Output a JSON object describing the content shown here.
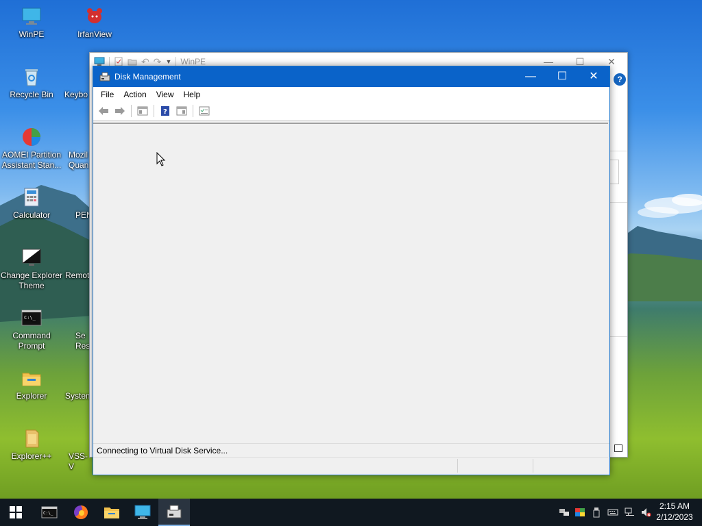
{
  "desktop": {
    "icons": [
      {
        "label": "WinPE"
      },
      {
        "label": "IrfanView"
      },
      {
        "label": "Recycle Bin"
      },
      {
        "label": "Keybo"
      },
      {
        "label": "AOMEI Partition Assistant Stan..."
      },
      {
        "label": "Mozil Quan"
      },
      {
        "label": "Calculator"
      },
      {
        "label": "PEN"
      },
      {
        "label": "Change Explorer Theme"
      },
      {
        "label": "Remot"
      },
      {
        "label": "Command Prompt"
      },
      {
        "label": "Se Res"
      },
      {
        "label": "Explorer"
      },
      {
        "label": "System"
      },
      {
        "label": "Explorer++"
      },
      {
        "label": "VSS-V"
      }
    ]
  },
  "back_window": {
    "title": "WinPE"
  },
  "disk_management": {
    "title": "Disk Management",
    "menu": [
      "File",
      "Action",
      "View",
      "Help"
    ],
    "status": "Connecting to Virtual Disk Service..."
  },
  "taskbar": {
    "time": "2:15 AM",
    "date": "2/12/2023"
  },
  "colors": {
    "titlebar": "#0a63c9",
    "taskbar": "#101820"
  }
}
